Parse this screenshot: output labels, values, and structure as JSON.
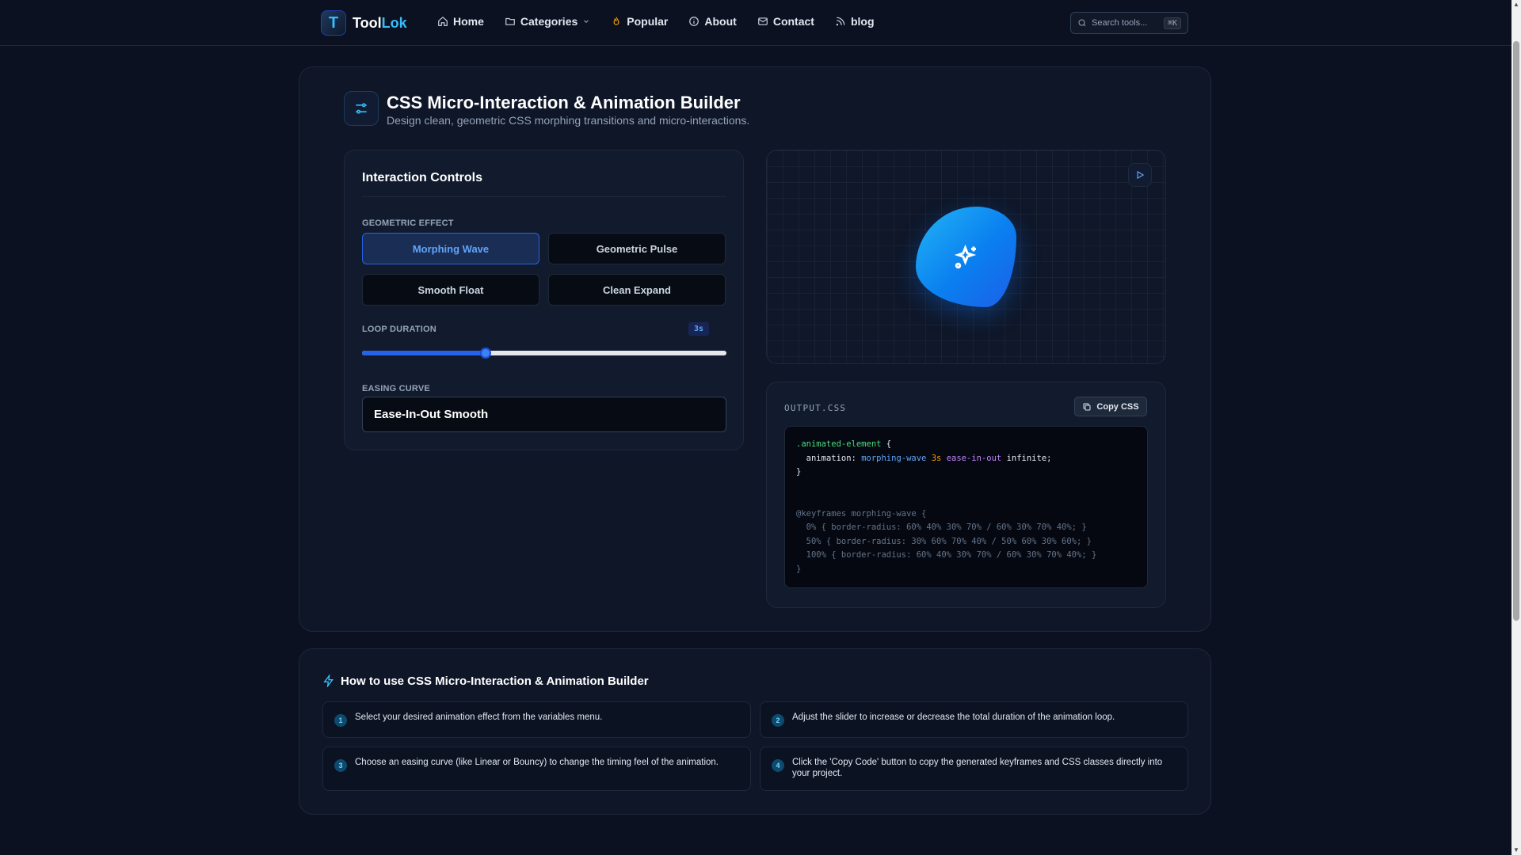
{
  "header": {
    "logo_mark": "T",
    "brand_primary": "Tool",
    "brand_accent": "Lok",
    "nav": [
      {
        "label": "Home",
        "icon": "home-icon"
      },
      {
        "label": "Categories",
        "icon": "folder-icon"
      },
      {
        "label": "Popular",
        "icon": "flame-icon"
      },
      {
        "label": "About",
        "icon": "info-icon"
      },
      {
        "label": "Contact",
        "icon": "mail-icon"
      },
      {
        "label": "blog",
        "icon": "rss-icon"
      }
    ],
    "search_placeholder": "Search tools...",
    "search_shortcut": "⌘K"
  },
  "tool": {
    "title": "CSS Micro-Interaction & Animation Builder",
    "subtitle": "Design clean, geometric CSS morphing transitions and micro-interactions."
  },
  "controls": {
    "title": "Interaction Controls",
    "effect_label": "GEOMETRIC EFFECT",
    "effects": [
      "Morphing Wave",
      "Geometric Pulse",
      "Smooth Float",
      "Clean Expand"
    ],
    "active_effect": "Morphing Wave",
    "duration_label": "LOOP DURATION",
    "duration_value": "3s",
    "duration_fraction": 0.34,
    "easing_label": "EASING CURVE",
    "easing_value": "Ease-In-Out Smooth"
  },
  "output": {
    "label": "OUTPUT.CSS",
    "copy_label": "Copy CSS",
    "code": {
      "selector": ".animated-element",
      "property": "animation:",
      "name": "morphing-wave",
      "duration": "3s",
      "easing": "ease-in-out",
      "iteration": "infinite;",
      "keyframes": [
        "@keyframes morphing-wave {",
        "  0% { border-radius: 60% 40% 30% 70% / 60% 30% 70% 40%; }",
        "  50% { border-radius: 30% 60% 70% 40% / 50% 60% 30% 60%; }",
        "  100% { border-radius: 60% 40% 30% 70% / 60% 30% 70% 40%; }",
        "}"
      ]
    }
  },
  "howto": {
    "title": "How to use CSS Micro-Interaction & Animation Builder",
    "steps": [
      {
        "num": "1",
        "text": "Select your desired animation effect from the variables menu."
      },
      {
        "num": "2",
        "text": "Adjust the slider to increase or decrease the total duration of the animation loop."
      },
      {
        "num": "3",
        "text": "Choose an easing curve (like Linear or Bouncy) to change the timing feel of the animation."
      },
      {
        "num": "4",
        "text": "Click the 'Copy Code' button to copy the generated keyframes and CSS classes directly into your project."
      }
    ]
  },
  "colors": {
    "background": "#0b1120",
    "accent": "#3b82f6",
    "brand": "#38bdf8"
  }
}
